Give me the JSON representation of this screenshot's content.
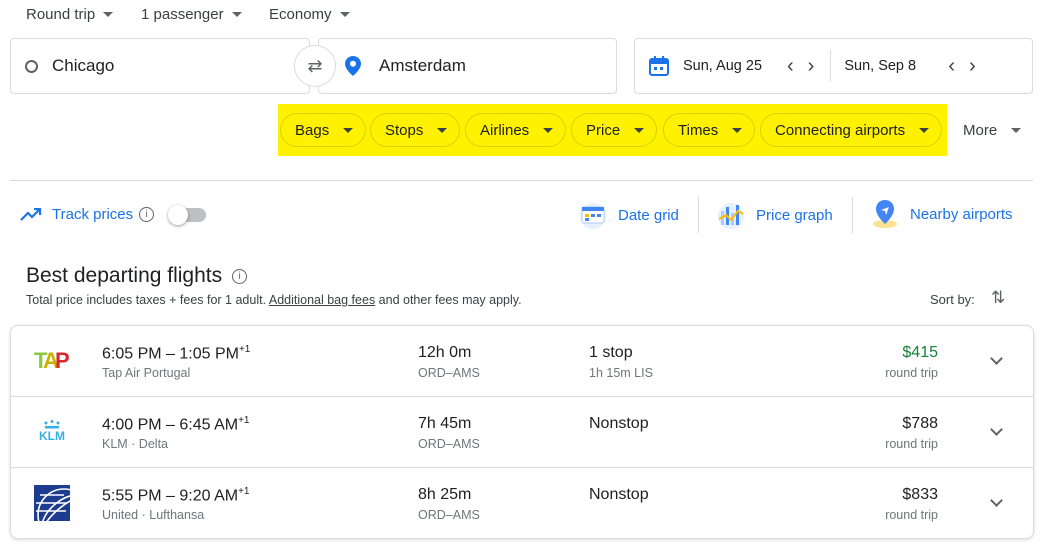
{
  "trip_options": {
    "trip_type": "Round trip",
    "passengers": "1 passenger",
    "cabin": "Economy"
  },
  "search": {
    "origin": "Chicago",
    "destination": "Amsterdam",
    "depart_date": "Sun, Aug 25",
    "return_date": "Sun, Sep 8"
  },
  "filters": [
    {
      "label": "Bags"
    },
    {
      "label": "Stops"
    },
    {
      "label": "Airlines"
    },
    {
      "label": "Price"
    },
    {
      "label": "Times"
    },
    {
      "label": "Connecting airports"
    }
  ],
  "more_label": "More",
  "highlight_color": "#fff200",
  "tools": {
    "track_prices": "Track prices",
    "track_enabled": false,
    "date_grid": "Date grid",
    "price_graph": "Price graph",
    "nearby_airports": "Nearby airports"
  },
  "results": {
    "title": "Best departing flights",
    "subtitle_pre": "Total price includes taxes + fees for 1 adult. ",
    "bag_fees_link": "Additional bag fees",
    "subtitle_post": " and other fees may apply.",
    "sort_label": "Sort by:",
    "flights": [
      {
        "logo": "tap-logo",
        "times": "6:05 PM – 1:05 PM",
        "day_offset": "+1",
        "airlines": "Tap Air Portugal",
        "duration": "12h 0m",
        "route": "ORD–AMS",
        "stops": "1 stop",
        "stop_detail": "1h 15m LIS",
        "price": "$415",
        "price_note": "round trip",
        "price_color": "#188038"
      },
      {
        "logo": "klm-logo",
        "times": "4:00 PM – 6:45 AM",
        "day_offset": "+1",
        "airlines": "KLM · Delta",
        "duration": "7h 45m",
        "route": "ORD–AMS",
        "stops": "Nonstop",
        "stop_detail": "",
        "price": "$788",
        "price_note": "round trip",
        "price_color": "#202124"
      },
      {
        "logo": "united-logo",
        "times": "5:55 PM – 9:20 AM",
        "day_offset": "+1",
        "airlines": "United · Lufthansa",
        "duration": "8h 25m",
        "route": "ORD–AMS",
        "stops": "Nonstop",
        "stop_detail": "",
        "price": "$833",
        "price_note": "round trip",
        "price_color": "#202124"
      }
    ]
  }
}
